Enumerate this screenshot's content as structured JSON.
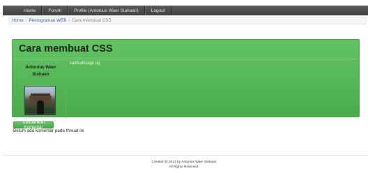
{
  "nav": {
    "items": [
      {
        "label": "Home"
      },
      {
        "label": "Forum"
      },
      {
        "label": "Profile (Antonius Waer Siahaan)"
      },
      {
        "label": "Logout"
      }
    ]
  },
  "breadcrumb": {
    "home": "Home",
    "category": "Pemograman WEB",
    "separator": "/",
    "current": "Cara membuat CSS"
  },
  "thread": {
    "title": "Cara membuat CSS",
    "author_first": "Antonius Waer",
    "author_last": "Siahaan",
    "body": "kadfkafksagk.og"
  },
  "comments": {
    "add_button_label": "Tambahkan Komentar",
    "empty_message": "Belum ada komentar pada thread ini"
  },
  "footer": {
    "line1": "Created @ 2014 by Antonius Waer Siahaan",
    "line2": "All Rights Reserved."
  },
  "colors": {
    "navbar": "#4a4a4a",
    "panel_green": "#5cb85c",
    "link_blue": "#2a6db5"
  }
}
